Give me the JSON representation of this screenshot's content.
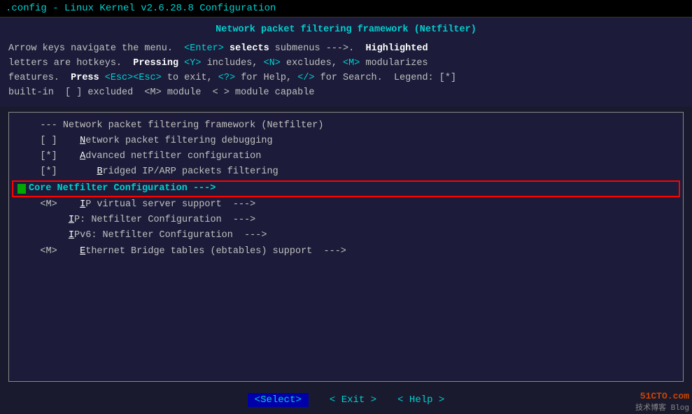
{
  "titleBar": {
    "text": ".config - Linux Kernel v2.6.28.8 Configuration"
  },
  "infoSection": {
    "title": "Network packet filtering framework (Netfilter)",
    "lines": [
      "Arrow keys navigate the menu.  <Enter> selects submenus --->.  Highlighted",
      "letters are hotkeys.  Pressing <Y> includes, <N> excludes, <M> modularizes",
      "features.  Press <Esc><Esc> to exit, <?> for Help, </> for Search.  Legend: [*]",
      "built-in  [ ] excluded  <M> module  < > module capable"
    ]
  },
  "menu": {
    "items": [
      {
        "type": "header",
        "text": "--- Network packet filtering framework (Netfilter)"
      },
      {
        "type": "item",
        "prefix": "[ ]",
        "hotkey": "N",
        "rest": "etwork packet filtering debugging"
      },
      {
        "type": "item",
        "prefix": "[*]",
        "hotkey": "A",
        "rest": "dvanced netfilter configuration"
      },
      {
        "type": "item",
        "prefix": "[*]",
        "hotkey": "B",
        "rest": "ridged IP/ARP packets filtering"
      },
      {
        "type": "selected",
        "text": "Core Netfilter Configuration  --->"
      },
      {
        "type": "item",
        "prefix": "<M>",
        "hotkey": "I",
        "rest": "P virtual server support  --->"
      },
      {
        "type": "item",
        "prefix": "   ",
        "hotkey": "I",
        "rest": "P: Netfilter Configuration  --->"
      },
      {
        "type": "item",
        "prefix": "   ",
        "hotkey": "I",
        "rest": "Pv6: Netfilter Configuration  --->"
      },
      {
        "type": "item",
        "prefix": "<M>",
        "hotkey": "E",
        "rest": "thernet Bridge tables (ebtables) support  --->"
      }
    ]
  },
  "buttons": {
    "select": "<Select>",
    "exit": "< Exit >",
    "help": "< Help >"
  },
  "watermark": {
    "line1": "51CTO.com",
    "line2": "技术博客 Blog"
  }
}
